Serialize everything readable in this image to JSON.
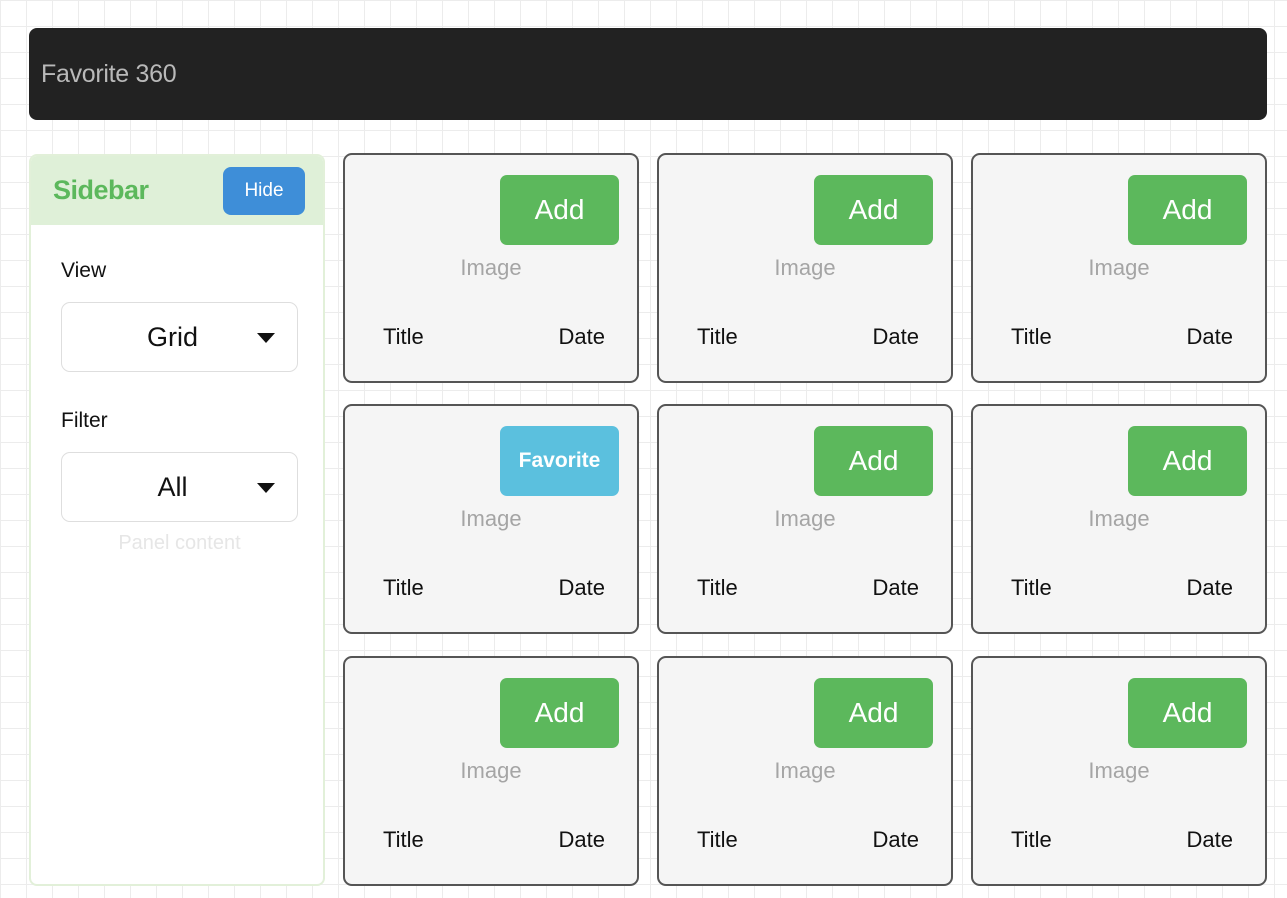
{
  "app": {
    "title": "Favorite 360"
  },
  "sidebar": {
    "title": "Sidebar",
    "hide_label": "Hide",
    "view": {
      "label": "View",
      "selected": "Grid"
    },
    "filter": {
      "label": "Filter",
      "selected": "All"
    },
    "panel_content": "Panel content"
  },
  "cards": [
    {
      "button": "Add",
      "button_type": "add",
      "image": "Image",
      "title": "Title",
      "date": "Date"
    },
    {
      "button": "Add",
      "button_type": "add",
      "image": "Image",
      "title": "Title",
      "date": "Date"
    },
    {
      "button": "Add",
      "button_type": "add",
      "image": "Image",
      "title": "Title",
      "date": "Date"
    },
    {
      "button": "Favorite",
      "button_type": "favorite",
      "image": "Image",
      "title": "Title",
      "date": "Date"
    },
    {
      "button": "Add",
      "button_type": "add",
      "image": "Image",
      "title": "Title",
      "date": "Date"
    },
    {
      "button": "Add",
      "button_type": "add",
      "image": "Image",
      "title": "Title",
      "date": "Date"
    },
    {
      "button": "Add",
      "button_type": "add",
      "image": "Image",
      "title": "Title",
      "date": "Date"
    },
    {
      "button": "Add",
      "button_type": "add",
      "image": "Image",
      "title": "Title",
      "date": "Date"
    },
    {
      "button": "Add",
      "button_type": "add",
      "image": "Image",
      "title": "Title",
      "date": "Date"
    }
  ],
  "colors": {
    "topbar": "#222222",
    "sidebar_header": "#dff0d8",
    "sidebar_title": "#5cb85c",
    "hide_button": "#3e8ed8",
    "add_button": "#5cb85c",
    "favorite_button": "#5bc0de",
    "card_border": "#555555",
    "card_background": "#f5f5f5"
  },
  "icons": {
    "select_caret": "caret-down-icon"
  }
}
